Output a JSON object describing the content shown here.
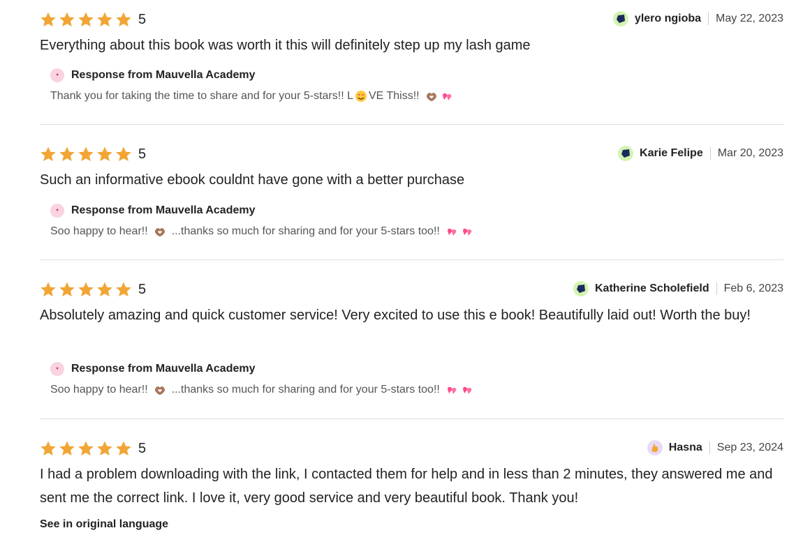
{
  "colors": {
    "star": "#F1A535",
    "divider": "#dddddd",
    "avatar_green": "#d4f3b2",
    "avatar_purple": "#e8d9f5",
    "logo_pink": "#f9d3e0"
  },
  "reviews": [
    {
      "rating": "5",
      "reviewer": "ylero ngioba",
      "date": "May 22, 2023",
      "text": "Everything about this book was worth it this will definitely step up my lash game",
      "response_title": "Response from Mauvella Academy",
      "response_text_before": "Thank you for taking the time to share and for your 5-stars!! L",
      "response_text_after": "VE Thiss!!",
      "avatar_icon": "hexagon-navy-icon"
    },
    {
      "rating": "5",
      "reviewer": "Karie Felipe",
      "date": "Mar 20, 2023",
      "text": "Such an informative ebook couldnt have gone with a better purchase",
      "response_title": "Response from Mauvella Academy",
      "response_text_1": "Soo happy to hear!!",
      "response_text_2": "...thanks so much for sharing and for your 5-stars too!!",
      "avatar_icon": "hexagon-navy-icon"
    },
    {
      "rating": "5",
      "reviewer": "Katherine Scholefield",
      "date": "Feb 6, 2023",
      "text": "Absolutely amazing and quick customer service! Very excited to use this e book! Beautifully laid out! Worth the buy!",
      "response_title": "Response from Mauvella Academy",
      "response_text_1": "Soo happy to hear!!",
      "response_text_2": "...thanks so much for sharing and for your 5-stars too!!",
      "avatar_icon": "hexagon-navy-icon"
    },
    {
      "rating": "5",
      "reviewer": "Hasna",
      "date": "Sep 23, 2024",
      "text": "I had a problem downloading with the link, I contacted them for help and in less than 2 minutes, they answered me and sent me the correct link. I love it, very good service and very beautiful book. Thank you!",
      "see_original": "See in original language",
      "avatar_icon": "hand-orange-icon"
    }
  ],
  "icons": {
    "star": "star-icon",
    "heart_eyes": "heart-eyes-emoji-icon",
    "heart_hands": "heart-hands-emoji-icon",
    "two_hearts": "two-hearts-emoji-icon"
  }
}
